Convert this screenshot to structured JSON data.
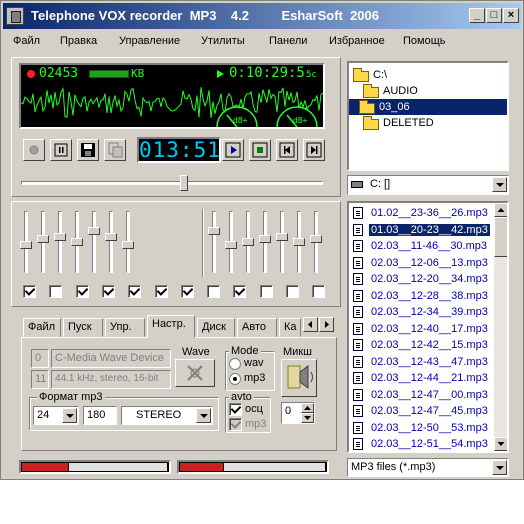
{
  "window": {
    "title": "Telephone VOX recorder  MP3    4.2         EsharSoft  2006",
    "controls": {
      "minimize": "_",
      "maximize": "□",
      "close": "×"
    }
  },
  "menu": [
    "Файл",
    "Правка",
    "Управление",
    "Утилиты",
    "Панели",
    "Избранное",
    "Помощь"
  ],
  "display": {
    "counter": "02453",
    "unit": "KB",
    "time": "0:10:29:5",
    "time_suffix": "5c",
    "gauge_left": "dB+",
    "gauge_right": "dB+"
  },
  "transport": {
    "timer": "013:51",
    "buttons": [
      "record-button",
      "pause-button",
      "save-button",
      "copy-button",
      "play-button",
      "stop-button",
      "prev-button",
      "next-button"
    ]
  },
  "position_level": 0.54,
  "eq": {
    "left_levels": [
      0.45,
      0.55,
      0.6,
      0.5,
      0.7,
      0.6,
      0.45
    ],
    "right_levels": [
      0.7,
      0.45,
      0.5,
      0.55,
      0.6,
      0.5,
      0.55
    ],
    "checks": [
      true,
      false,
      true,
      true,
      true,
      true,
      true,
      false,
      true,
      false,
      false,
      false
    ]
  },
  "tabs": {
    "items": [
      "Файл",
      "Пуск",
      "Упр.",
      "Настр.",
      "Диск",
      "Авто",
      "Ка"
    ],
    "active": 3
  },
  "settings": {
    "device_index": "0",
    "device_name": "C-Media Wave Device",
    "format_index": "11",
    "format_desc": "44.1 kHz, stereo, 16-bit",
    "wave_label": "Wave",
    "mode_label": "Mode",
    "mode_wav": "wav",
    "mode_mp3": "mp3",
    "mixer_label": "Микш",
    "mp3_format_label": "Формат mp3",
    "bitrate": "24",
    "samplerate": "180",
    "channels": "STEREO",
    "auto_label": "avto",
    "auto_osc": "осц",
    "auto_mp3": "mp3",
    "spin_value": "0"
  },
  "tree": {
    "items": [
      {
        "label": "C:\\",
        "icon": "folder-open-icon"
      },
      {
        "label": "AUDIO",
        "icon": "folder-open-icon"
      },
      {
        "label": "03_06",
        "icon": "folder-open-icon",
        "selected": true
      },
      {
        "label": "DELETED",
        "icon": "folder-icon"
      }
    ]
  },
  "drive": "C: []",
  "files": [
    "01.02__23-36__26.mp3",
    "01.03__20-23__42.mp3",
    "02.03__11-46__30.mp3",
    "02.03__12-06__13.mp3",
    "02.03__12-20__34.mp3",
    "02.03__12-28__38.mp3",
    "02.03__12-34__39.mp3",
    "02.03__12-40__17.mp3",
    "02.03__12-42__15.mp3",
    "02.03__12-43__47.mp3",
    "02.03__12-44__21.mp3",
    "02.03__12-47__00.mp3",
    "02.03__12-47__45.mp3",
    "02.03__12-50__53.mp3",
    "02.03__12-51__54.mp3"
  ],
  "selected_file": 1,
  "file_filter": "MP3 files (*.mp3)",
  "meters": {
    "left": 0.32,
    "right": 0.3
  },
  "colors": {
    "accent": "#0a246a",
    "lcd": "#22ff22",
    "timer": "#00c8ff",
    "meter": "#cc2020"
  }
}
